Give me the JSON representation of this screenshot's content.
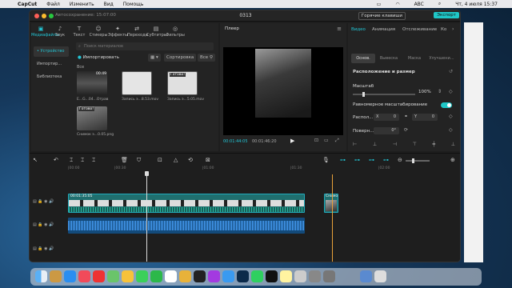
{
  "menubar": {
    "apple": "",
    "app": "CapCut",
    "items": [
      "Файл",
      "Изменить",
      "Вид",
      "Помощь"
    ],
    "clock": "Чт, 4 июля 15:37",
    "kb": "ABC"
  },
  "window": {
    "autosave": "Автосохранение: 15:07:00",
    "project": "0313",
    "hotkeys": "Горячие клавиши",
    "export": "Экспорт"
  },
  "media_tabs": [
    {
      "label": "Медиафайлы",
      "icon": "▣"
    },
    {
      "label": "Звук",
      "icon": "♪"
    },
    {
      "label": "Текст",
      "icon": "T"
    },
    {
      "label": "Стикеры",
      "icon": "☺"
    },
    {
      "label": "Эффекты",
      "icon": "✦"
    },
    {
      "label": "Переходы",
      "icon": "⇄"
    },
    {
      "label": "Субтитры",
      "icon": "▤"
    },
    {
      "label": "Фильтры",
      "icon": "◎"
    }
  ],
  "sidebar": [
    "• Устройство",
    "Импортир...",
    "Библиотека"
  ],
  "media": {
    "search_placeholder": "Поиск материалов",
    "import": "Импортировать",
    "sort": "Сортировка",
    "all": "Все",
    "section": "Все",
    "items": [
      {
        "label": "E...G...04...Отрав",
        "dur": "00:49",
        "badge": ""
      },
      {
        "label": "Запись э...8.53.mov",
        "dur": "",
        "badge": ""
      },
      {
        "label": "Запись э...5.05.mov",
        "dur": "",
        "badge": "Готово!"
      },
      {
        "label": "Снимок э...0.05.png",
        "dur": "",
        "badge": "Готово!"
      }
    ]
  },
  "player": {
    "title": "Плеер",
    "time_current": "00:01:44:05",
    "time_total": "00:01:46:20"
  },
  "right_panel": {
    "tabs": [
      "Видео",
      "Анимация",
      "Отслеживание",
      "Ко"
    ],
    "subtabs": [
      "Основ.",
      "Вывеска",
      "Маска",
      "Улучшени..."
    ],
    "section": "Расположение и размер",
    "scale_label": "Масштаб",
    "scale_value": "100%",
    "uniform": "Равномерное масштабирование",
    "pos_label": "Распол...",
    "pos_x": "0",
    "pos_y": "0",
    "x": "X",
    "y": "Y",
    "rot_label": "Поверн...",
    "rot_value": "0°"
  },
  "timeline": {
    "ruler": [
      "|00:00",
      "|00:30",
      "|01:00",
      "|01:30",
      "|02:00"
    ],
    "clip_label": "00:01:35:05",
    "img_clip_label": "Снимо"
  }
}
